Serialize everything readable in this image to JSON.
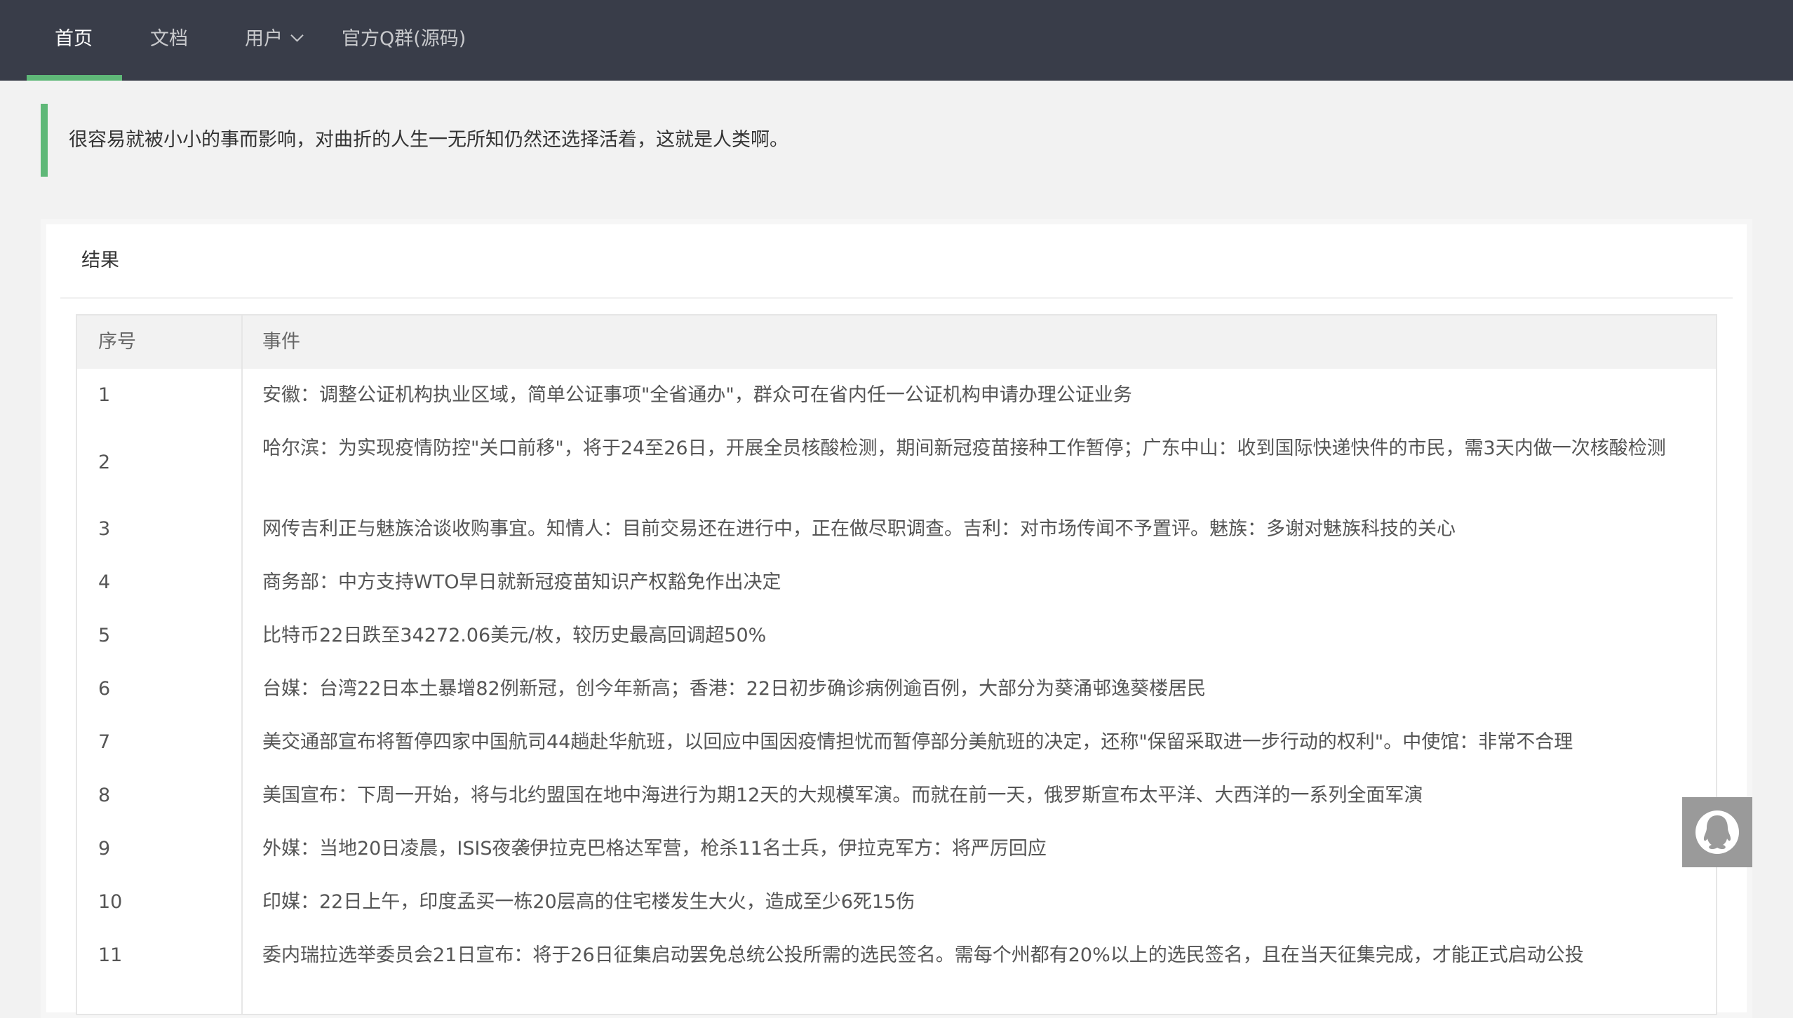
{
  "nav": {
    "items": [
      {
        "label": "首页",
        "active": true
      },
      {
        "label": "文档"
      },
      {
        "label": "用户",
        "has_dropdown": true
      },
      {
        "label": "官方Q群(源码)"
      }
    ]
  },
  "quote": {
    "text": "很容易就被小小的事而影响，对曲折的人生一无所知仍然还选择活着，这就是人类啊。"
  },
  "card": {
    "title": "结果",
    "table": {
      "headers": [
        "序号",
        "事件"
      ],
      "rows": [
        {
          "no": "1",
          "event": "安徽：调整公证机构执业区域，简单公证事项\"全省通办\"，群众可在省内任一公证机构申请办理公证业务"
        },
        {
          "no": "2",
          "event": "哈尔滨：为实现疫情防控\"关口前移\"，将于24至26日，开展全员核酸检测，期间新冠疫苗接种工作暂停；广东中山：收到国际快递快件的市民，需3天内做一次核酸检测"
        },
        {
          "no": "3",
          "event": "网传吉利正与魅族洽谈收购事宜。知情人：目前交易还在进行中，正在做尽职调查。吉利：对市场传闻不予置评。魅族：多谢对魅族科技的关心"
        },
        {
          "no": "4",
          "event": "商务部：中方支持WTO早日就新冠疫苗知识产权豁免作出决定"
        },
        {
          "no": "5",
          "event": "比特币22日跌至34272.06美元/枚，较历史最高回调超50%"
        },
        {
          "no": "6",
          "event": "台媒：台湾22日本土暴增82例新冠，创今年新高；香港：22日初步确诊病例逾百例，大部分为葵涌邨逸葵楼居民"
        },
        {
          "no": "7",
          "event": "美交通部宣布将暂停四家中国航司44趟赴华航班，以回应中国因疫情担忧而暂停部分美航班的决定，还称\"保留采取进一步行动的权利\"。中使馆：非常不合理"
        },
        {
          "no": "8",
          "event": "美国宣布：下周一开始，将与北约盟国在地中海进行为期12天的大规模军演。而就在前一天，俄罗斯宣布太平洋、大西洋的一系列全面军演"
        },
        {
          "no": "9",
          "event": "外媒：当地20日凌晨，ISIS夜袭伊拉克巴格达军营，枪杀11名士兵，伊拉克军方：将严厉回应"
        },
        {
          "no": "10",
          "event": "印媒：22日上午，印度孟买一栋20层高的住宅楼发生大火，造成至少6死15伤"
        },
        {
          "no": "11",
          "event": "委内瑞拉选举委员会21日宣布：将于26日征集启动罢免总统公投所需的选民签名。需每个州都有20%以上的选民签名，且在当天征集完成，才能正式启动公投"
        }
      ]
    }
  },
  "float": {
    "icon": "qq-penguin-icon"
  },
  "colors": {
    "nav_bg": "#393d49",
    "accent": "#5fb878"
  }
}
